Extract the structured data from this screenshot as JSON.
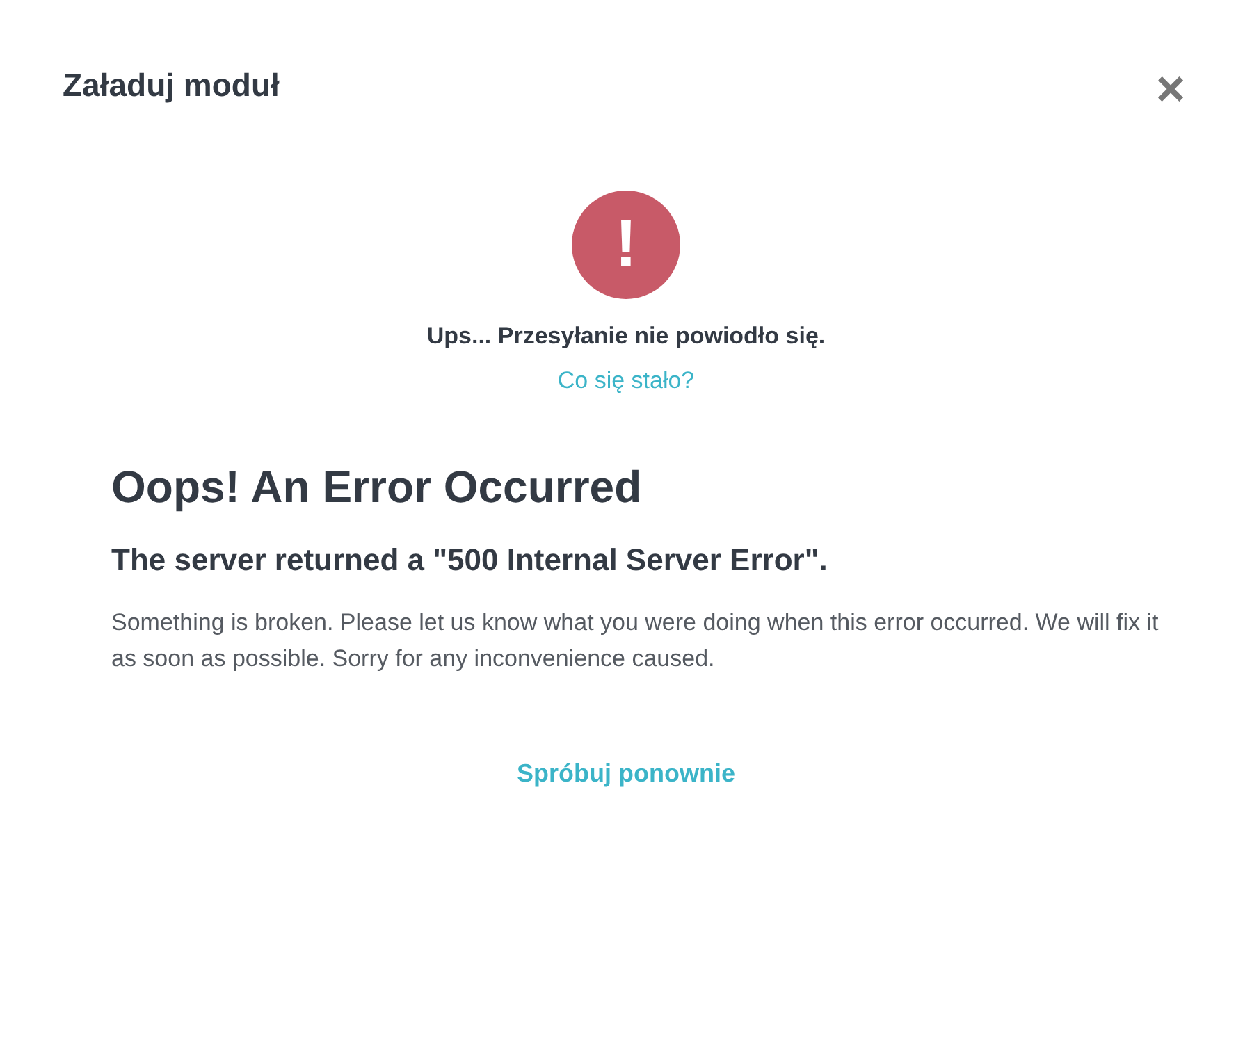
{
  "dialog": {
    "title": "Załaduj moduł",
    "close": "×"
  },
  "status": {
    "icon": "!",
    "message": "Ups... Przesyłanie nie powiodło się.",
    "link": "Co się stało?"
  },
  "error": {
    "heading": "Oops! An Error Occurred",
    "subheading": "The server returned a \"500 Internal Server Error\".",
    "body": "Something is broken. Please let us know what you were doing when this error occurred. We will fix it as soon as possible. Sorry for any inconvenience caused."
  },
  "retry": "Spróbuj ponownie"
}
